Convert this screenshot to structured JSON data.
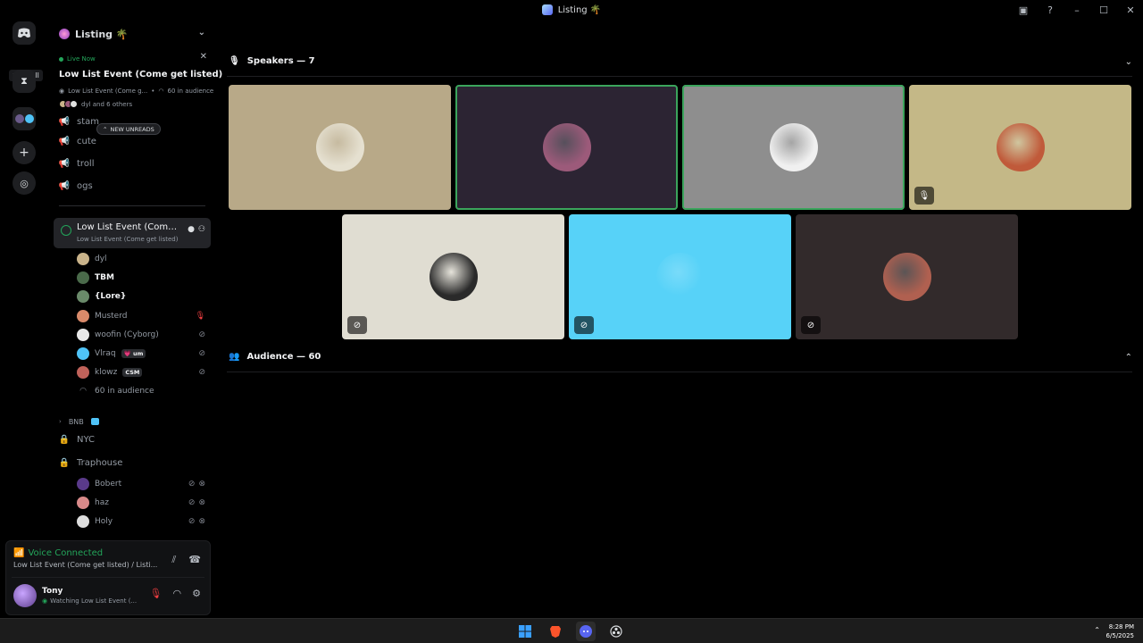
{
  "window": {
    "title": "Listing 🌴",
    "actions": [
      "inbox-icon",
      "help-icon",
      "minimize",
      "maximize",
      "close"
    ]
  },
  "rail": {
    "read_all": "read all"
  },
  "sidebar": {
    "guild_name": "Listing 🌴",
    "live_card": {
      "status": "Live Now",
      "title": "Low List Event (Come get listed)",
      "subtitle": "Low List Event (Come g...",
      "audience": "60 in audience",
      "people": "dyl and 6 others"
    },
    "channels_top": [
      {
        "name": "stam"
      },
      {
        "name": "cute"
      },
      {
        "name": "troll"
      },
      {
        "name": "ogs"
      }
    ],
    "new_unreads": "NEW UNREADS",
    "active_voice": {
      "name": "Low List Event (Come ...",
      "subtitle": "Low List Event (Come get listed)"
    },
    "members": [
      {
        "name": "dyl",
        "bold": false,
        "color": "#c9b38a",
        "right": ""
      },
      {
        "name": "TBM",
        "bold": true,
        "color": "#4a6a4a",
        "right": ""
      },
      {
        "name": "{Lore}",
        "bold": true,
        "color": "#6a8a6a",
        "right": ""
      },
      {
        "name": "Musterd",
        "bold": false,
        "color": "#d98a6a",
        "right": "red-mic"
      },
      {
        "name": "woofin (Cyborg)",
        "bold": false,
        "color": "#e8e8e8",
        "right": "mic-off"
      },
      {
        "name": "Vlraq",
        "bold": false,
        "color": "#4fc3f7",
        "right": "mic-off",
        "tag": "💗 um"
      },
      {
        "name": "klowz",
        "bold": false,
        "color": "#c0625a",
        "right": "mic-off",
        "tag": "CSM"
      }
    ],
    "audience_count": "60 in audience",
    "category": "BNB",
    "locked_channels": [
      {
        "name": "NYC"
      },
      {
        "name": "Traphouse"
      }
    ],
    "traphouse_members": [
      {
        "name": "Bobert",
        "color": "#5a3a8a"
      },
      {
        "name": "haz",
        "color": "#d98a8a"
      },
      {
        "name": "Holy",
        "color": "#dddddd"
      }
    ]
  },
  "panel": {
    "voice_status": "Voice Connected",
    "voice_channel": "Low List Event (Come get listed) / Listi...",
    "username": "Tony",
    "user_status": "Watching Low List Event (..."
  },
  "stage": {
    "speakers_title": "Speakers — 7",
    "audience_title": "Audience — 60",
    "tiles": [
      {
        "bg": "#b8a988",
        "avatar": "#e5e0d0",
        "speaking": false,
        "badge": ""
      },
      {
        "bg": "#2c2433",
        "avatar": "#9c5a7a",
        "speaking": true,
        "badge": ""
      },
      {
        "bg": "#8e8e8e",
        "avatar": "#f0f0f0",
        "speaking": true,
        "badge": ""
      },
      {
        "bg": "#c4b887",
        "avatar": "#c05a3a",
        "speaking": false,
        "badge": "suppressed-icon"
      },
      {
        "bg": "#e0ddd2",
        "avatar": "#2a2a2a",
        "speaking": false,
        "badge": "mic-off-icon"
      },
      {
        "bg": "#57d2f8",
        "avatar": "#57d2f8",
        "speaking": false,
        "badge": "mic-off-icon"
      },
      {
        "bg": "#322a2b",
        "avatar": "#b06050",
        "speaking": false,
        "badge": "mic-off-icon"
      }
    ]
  },
  "taskbar": {
    "time": "8:28 PM",
    "date": "6/5/2025",
    "apps": [
      "windows-start-icon",
      "brave-icon",
      "discord-icon",
      "obs-icon"
    ]
  }
}
